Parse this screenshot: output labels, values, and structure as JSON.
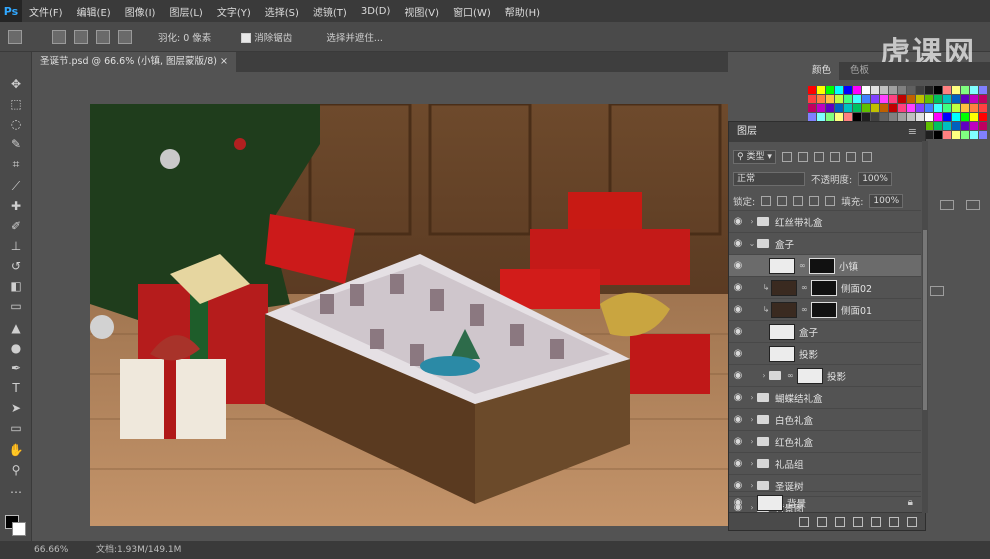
{
  "app": {
    "logo": "Ps",
    "watermark": "虎课网"
  },
  "menu": [
    "文件(F)",
    "编辑(E)",
    "图像(I)",
    "图层(L)",
    "文字(Y)",
    "选择(S)",
    "滤镜(T)",
    "3D(D)",
    "视图(V)",
    "窗口(W)",
    "帮助(H)"
  ],
  "options": {
    "feather": "羽化: 0 像素",
    "antialias": "消除锯齿",
    "refine": "选择并遮住..."
  },
  "doc_tab": "圣诞节.psd @ 66.6% (小镇, 图层蒙版/8)",
  "status": {
    "zoom": "66.66%",
    "doc": "文档:1.93M/149.1M"
  },
  "color_panel": {
    "tabs": [
      "颜色",
      "色板"
    ]
  },
  "layers": {
    "title": "图层",
    "search": "类型",
    "blend_mode": "正常",
    "opacity_label": "不透明度:",
    "opacity": "100%",
    "lock_label": "锁定:",
    "fill_label": "填充:",
    "fill": "100%",
    "items": [
      {
        "name": "红丝带礼盒",
        "type": "group",
        "level": 0
      },
      {
        "name": "盒子",
        "type": "group",
        "level": 0,
        "open": true
      },
      {
        "name": "小镇",
        "type": "masked",
        "level": 1,
        "selected": true
      },
      {
        "name": "侧面02",
        "type": "masked",
        "level": 1
      },
      {
        "name": "侧面01",
        "type": "masked",
        "level": 1
      },
      {
        "name": "盒子",
        "type": "pixel",
        "level": 1
      },
      {
        "name": "投影",
        "type": "pixel",
        "level": 1
      },
      {
        "name": "投影",
        "type": "group-mask",
        "level": 1
      },
      {
        "name": "蝴蝶结礼盒",
        "type": "group",
        "level": 0
      },
      {
        "name": "白色礼盒",
        "type": "group",
        "level": 0
      },
      {
        "name": "红色礼盒",
        "type": "group",
        "level": 0
      },
      {
        "name": "礼品组",
        "type": "group",
        "level": 0
      },
      {
        "name": "圣诞树",
        "type": "group",
        "level": 0
      },
      {
        "name": "背景图",
        "type": "group",
        "level": 0
      },
      {
        "name": "背景",
        "type": "background",
        "level": 0
      }
    ]
  },
  "colors": {
    "accent_blue": "#31a8ff"
  }
}
